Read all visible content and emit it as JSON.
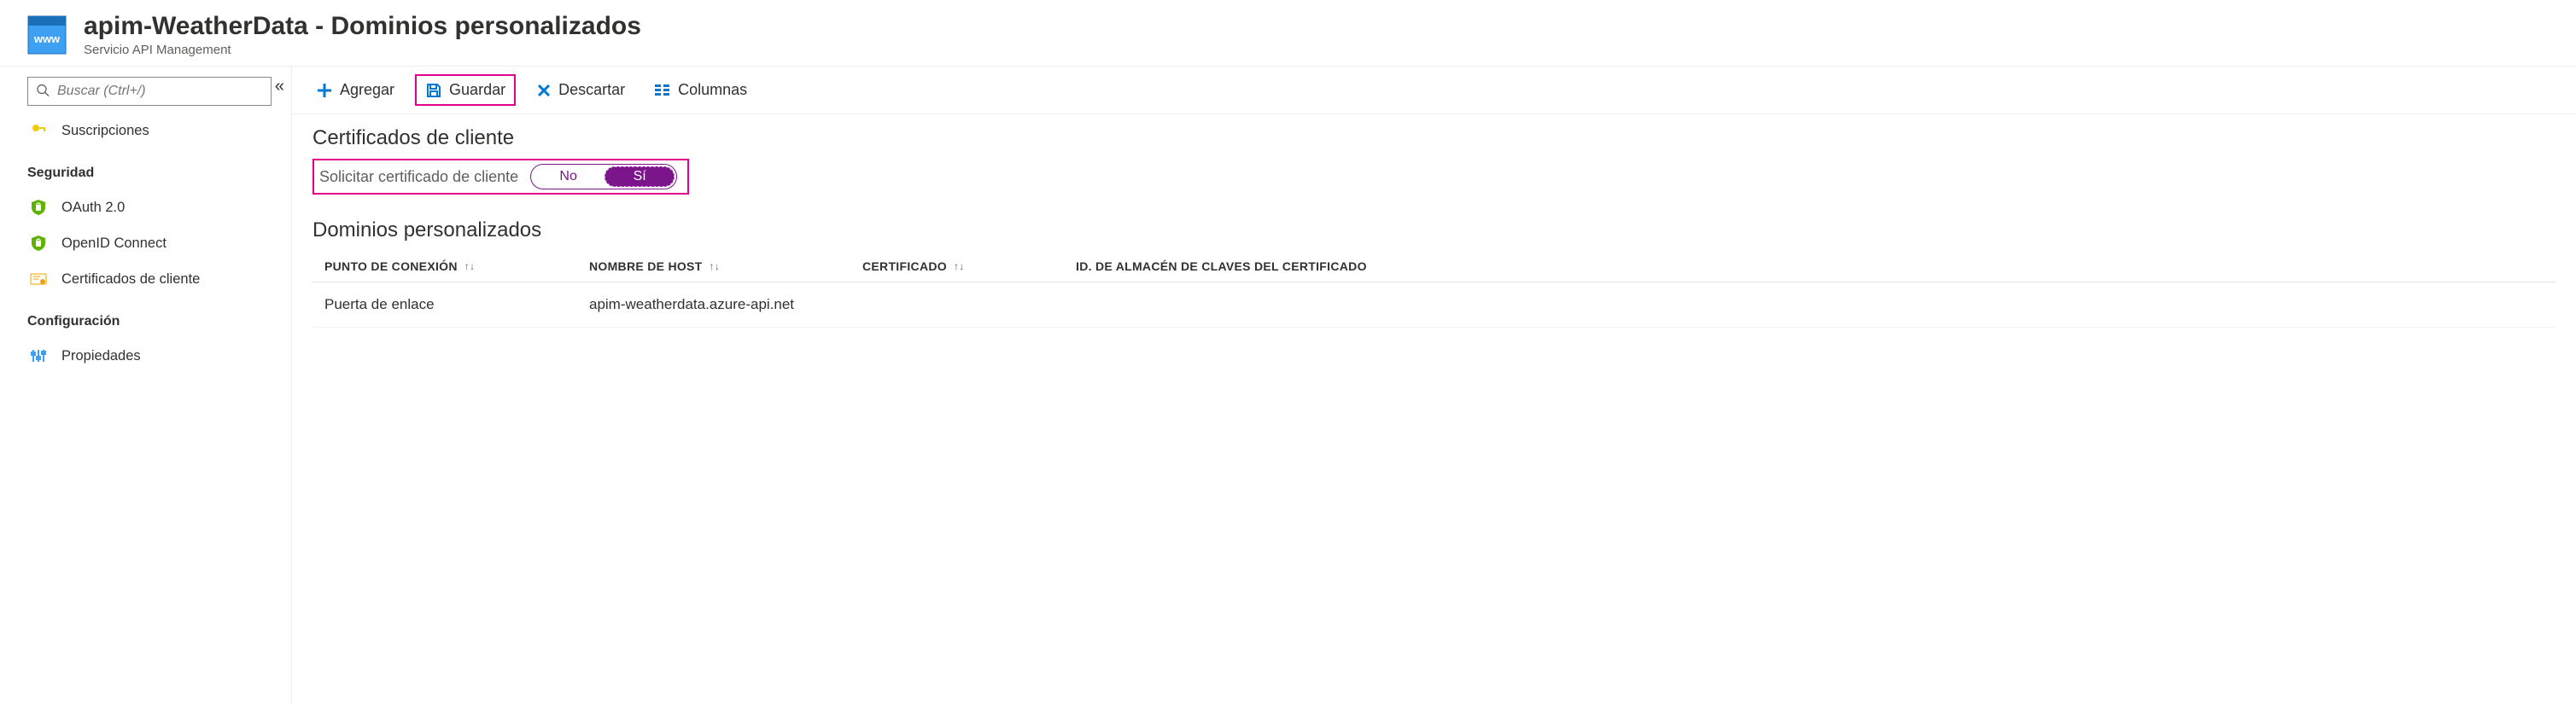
{
  "header": {
    "title": "apim-WeatherData - Dominios personalizados",
    "subtitle": "Servicio API Management"
  },
  "sidebar": {
    "search_placeholder": "Buscar (Ctrl+/)",
    "items": [
      {
        "icon": "key-icon",
        "label": "Suscripciones"
      }
    ],
    "groups": [
      {
        "header": "Seguridad",
        "items": [
          {
            "icon": "shield-green-icon",
            "label": "OAuth 2.0"
          },
          {
            "icon": "shield-green-icon",
            "label": "OpenID Connect"
          },
          {
            "icon": "certificate-icon",
            "label": "Certificados de cliente"
          }
        ]
      },
      {
        "header": "Configuración",
        "items": [
          {
            "icon": "sliders-icon",
            "label": "Propiedades"
          }
        ]
      }
    ]
  },
  "toolbar": {
    "add": "Agregar",
    "save": "Guardar",
    "discard": "Descartar",
    "columns": "Columnas"
  },
  "section1": {
    "title": "Certificados de cliente",
    "toggle_label": "Solicitar certificado de cliente",
    "toggle_off": "No",
    "toggle_on": "Sí",
    "toggle_value": true
  },
  "section2": {
    "title": "Dominios personalizados",
    "columns": {
      "c1": "PUNTO DE CONEXIÓN",
      "c2": "NOMBRE DE HOST",
      "c3": "CERTIFICADO",
      "c4": "ID. DE ALMACÉN DE CLAVES DEL CERTIFICADO"
    },
    "rows": [
      {
        "endpoint": "Puerta de enlace",
        "host": "apim-weatherdata.azure-api.net",
        "cert": "",
        "kv": ""
      }
    ]
  },
  "colors": {
    "primary": "#0078d4",
    "accent_hl": "#e3008c",
    "toggle_purple": "#7c158c"
  }
}
